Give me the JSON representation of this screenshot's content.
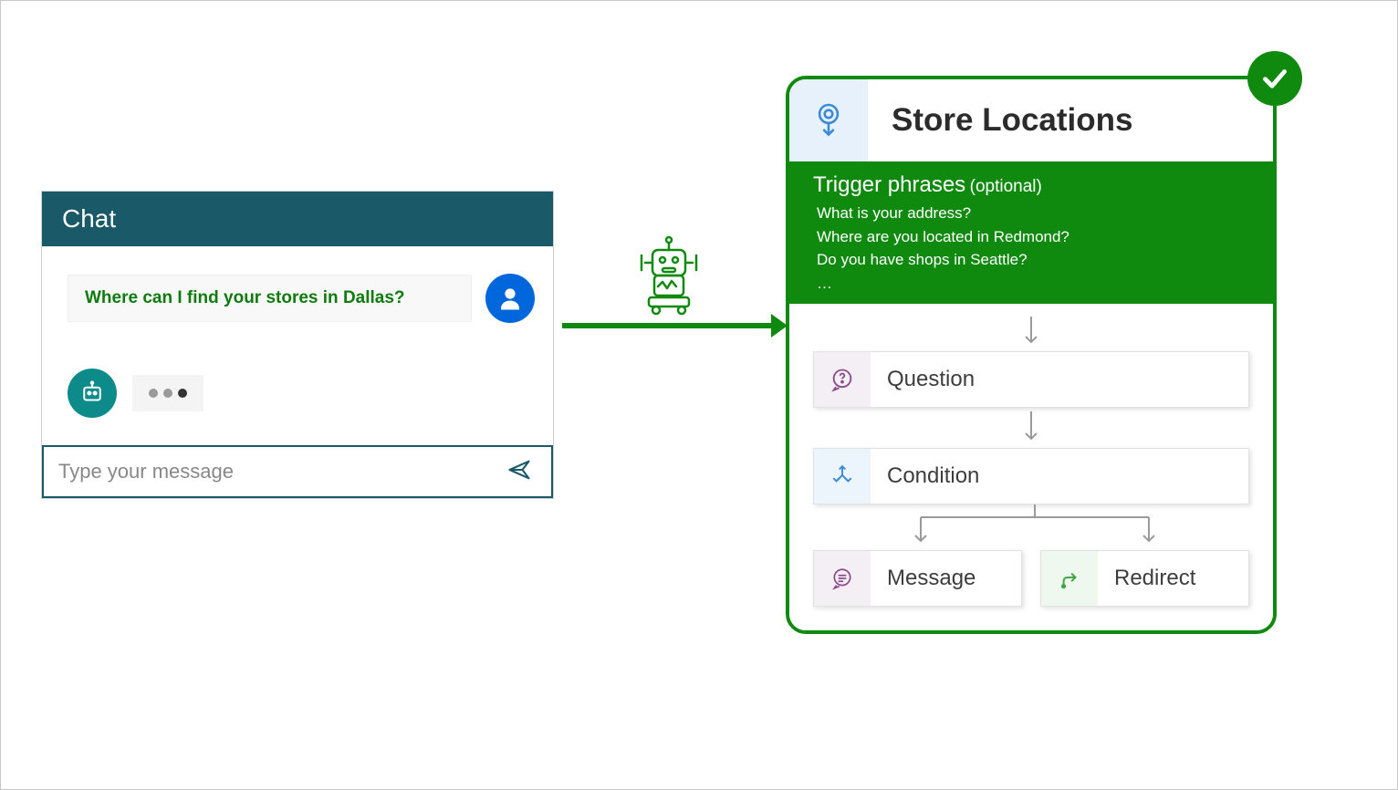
{
  "chat": {
    "header": "Chat",
    "user_message": "Where can I find your stores in Dallas?",
    "input_placeholder": "Type your message"
  },
  "topic": {
    "title": "Store Locations",
    "trigger_label": "Trigger phrases",
    "trigger_suffix": "(optional)",
    "phrases": [
      "What is your address?",
      "Where are you located in Redmond?",
      "Do you have shops in Seattle?",
      "…"
    ],
    "nodes": {
      "question": "Question",
      "condition": "Condition",
      "message": "Message",
      "redirect": "Redirect"
    }
  }
}
